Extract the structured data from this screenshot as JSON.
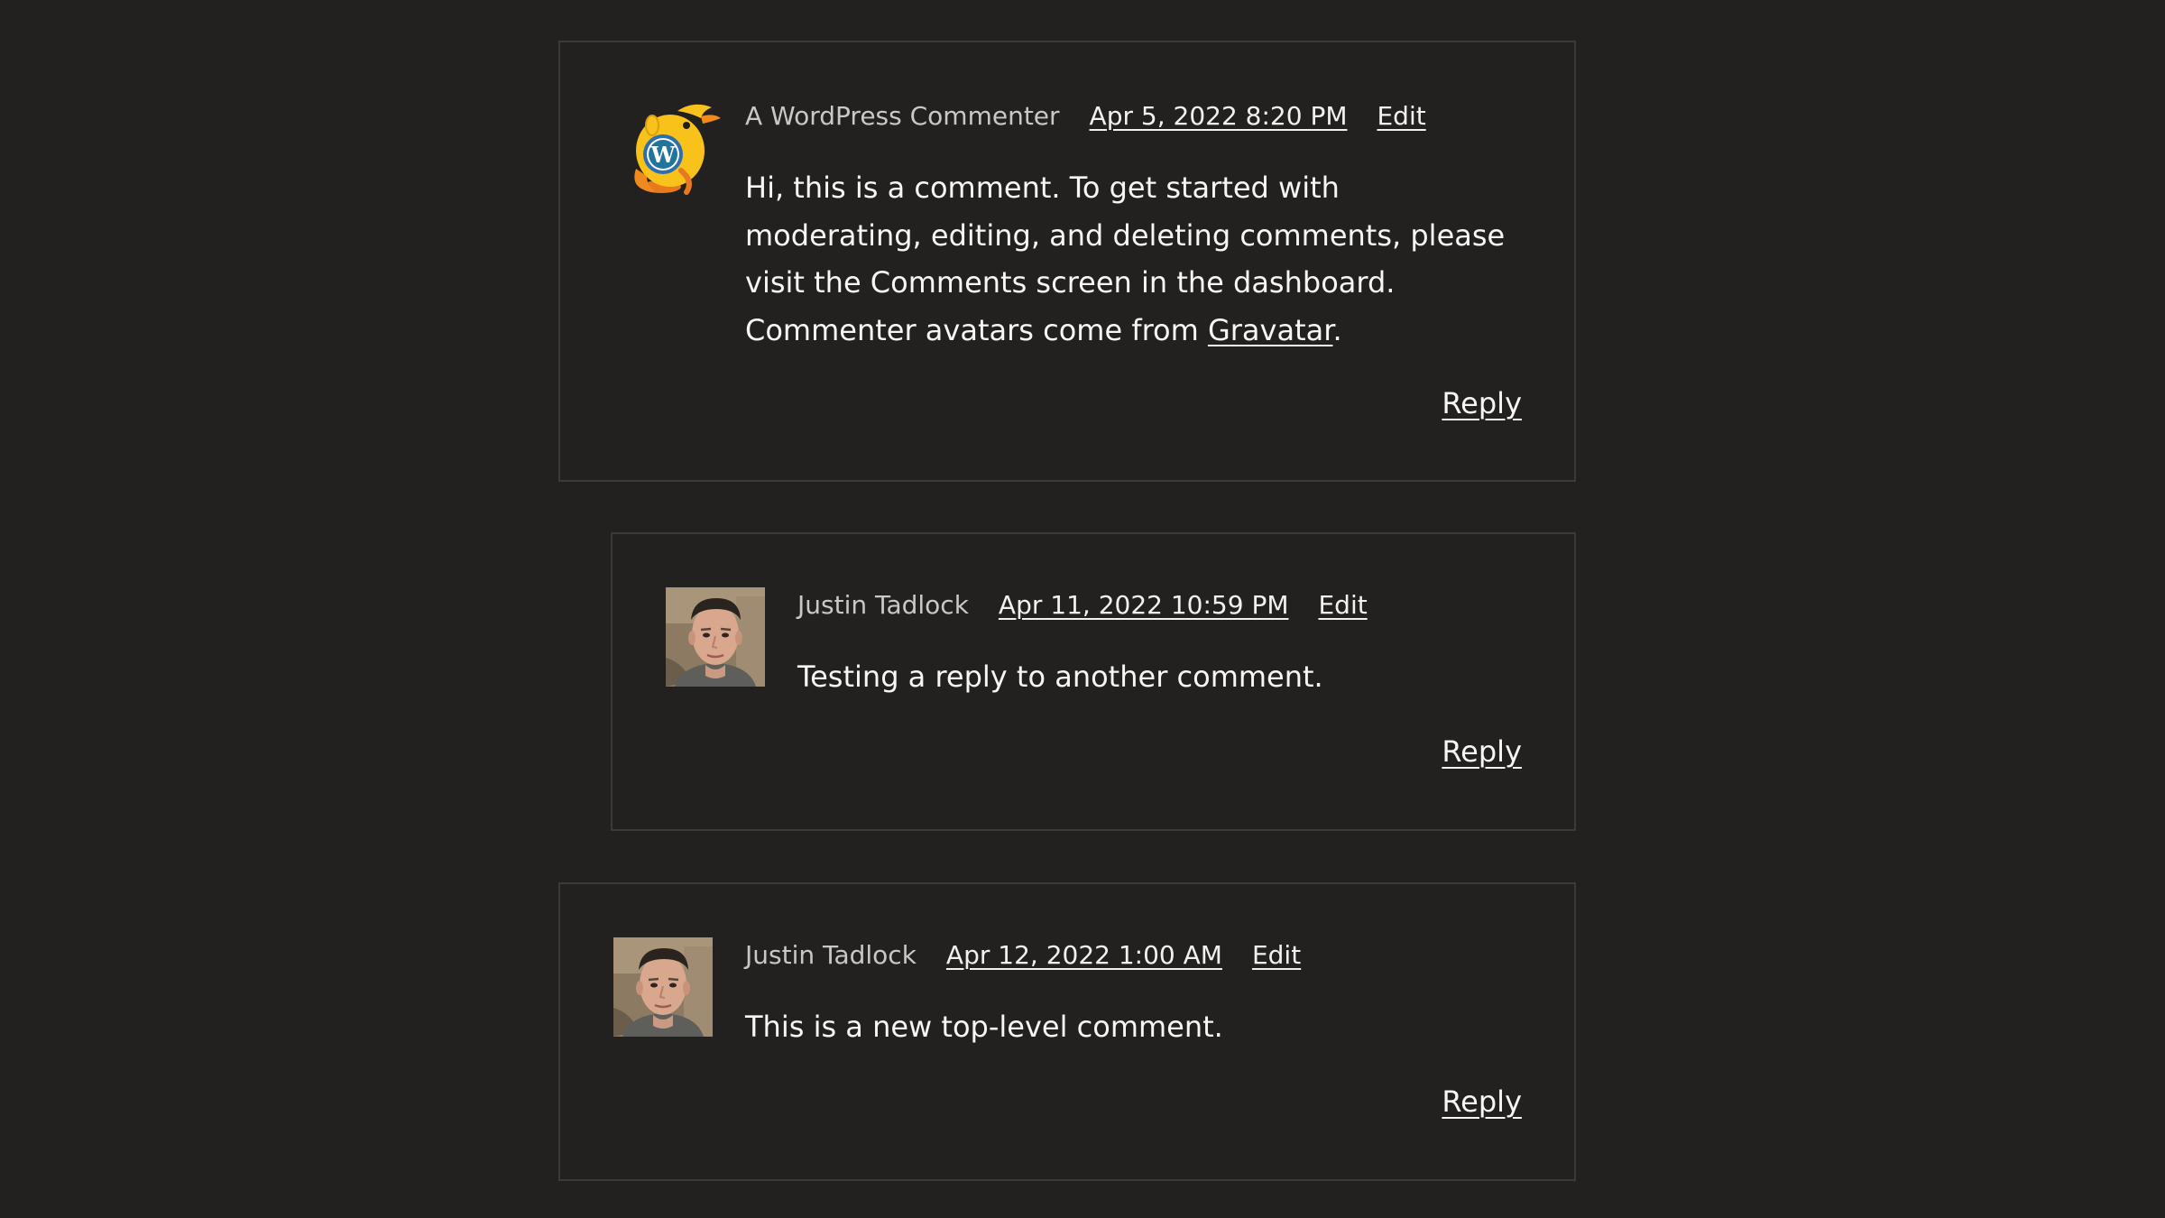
{
  "comments": [
    {
      "author": "A WordPress Commenter",
      "avatar_icon": "wapuu-wordpress-mascot-icon",
      "date": "Apr 5, 2022 8:20 PM",
      "edit_label": "Edit",
      "body_text": "Hi, this is a comment. To get started with moderating, editing, and deleting comments, please visit the Comments screen in the dashboard. Commenter avatars come from",
      "body_link": "Gravatar",
      "body_end": ".",
      "reply_label": "Reply"
    },
    {
      "author": "Justin Tadlock",
      "avatar_icon": "user-photo-avatar",
      "date": "Apr 11, 2022 10:59 PM",
      "edit_label": "Edit",
      "body_text": "Testing a reply to another comment.",
      "reply_label": "Reply"
    },
    {
      "author": "Justin Tadlock",
      "avatar_icon": "user-photo-avatar",
      "date": "Apr 12, 2022 1:00 AM",
      "edit_label": "Edit",
      "body_text": "This is a new top-level comment.",
      "reply_label": "Reply"
    }
  ],
  "colors": {
    "background": "#222120",
    "border": "#3b3a39",
    "text": "#f6f6f4",
    "author_text": "#c9c8c5"
  }
}
